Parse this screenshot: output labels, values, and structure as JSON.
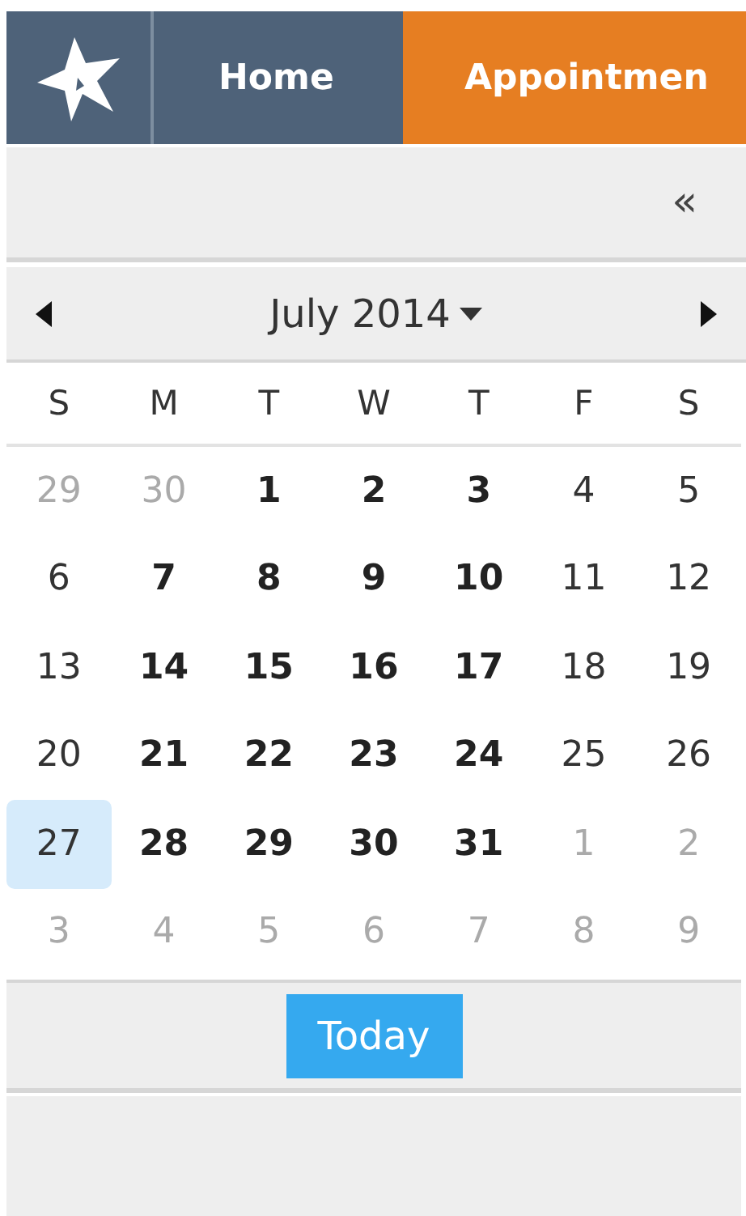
{
  "nav": {
    "tabs": [
      {
        "label": "Home",
        "selected": false
      },
      {
        "label": "Appointmen",
        "selected": true
      }
    ]
  },
  "toolbar": {
    "collapse": "«"
  },
  "calendar": {
    "month": "July 2014",
    "weekdays": [
      "S",
      "M",
      "T",
      "W",
      "T",
      "F",
      "S"
    ],
    "weeks": [
      [
        {
          "day": "29",
          "kind": "outside",
          "selected": false
        },
        {
          "day": "30",
          "kind": "outside",
          "selected": false
        },
        {
          "day": "1",
          "kind": "booked",
          "selected": false
        },
        {
          "day": "2",
          "kind": "booked",
          "selected": false
        },
        {
          "day": "3",
          "kind": "booked",
          "selected": false
        },
        {
          "day": "4",
          "kind": "plain",
          "selected": false
        },
        {
          "day": "5",
          "kind": "plain",
          "selected": false
        }
      ],
      [
        {
          "day": "6",
          "kind": "plain",
          "selected": false
        },
        {
          "day": "7",
          "kind": "booked",
          "selected": false
        },
        {
          "day": "8",
          "kind": "booked",
          "selected": false
        },
        {
          "day": "9",
          "kind": "booked",
          "selected": false
        },
        {
          "day": "10",
          "kind": "booked",
          "selected": false
        },
        {
          "day": "11",
          "kind": "plain",
          "selected": false
        },
        {
          "day": "12",
          "kind": "plain",
          "selected": false
        }
      ],
      [
        {
          "day": "13",
          "kind": "plain",
          "selected": false
        },
        {
          "day": "14",
          "kind": "booked",
          "selected": false
        },
        {
          "day": "15",
          "kind": "booked",
          "selected": false
        },
        {
          "day": "16",
          "kind": "booked",
          "selected": false
        },
        {
          "day": "17",
          "kind": "booked",
          "selected": false
        },
        {
          "day": "18",
          "kind": "plain",
          "selected": false
        },
        {
          "day": "19",
          "kind": "plain",
          "selected": false
        }
      ],
      [
        {
          "day": "20",
          "kind": "plain",
          "selected": false
        },
        {
          "day": "21",
          "kind": "booked",
          "selected": false
        },
        {
          "day": "22",
          "kind": "booked",
          "selected": false
        },
        {
          "day": "23",
          "kind": "booked",
          "selected": false
        },
        {
          "day": "24",
          "kind": "booked",
          "selected": false
        },
        {
          "day": "25",
          "kind": "plain",
          "selected": false
        },
        {
          "day": "26",
          "kind": "plain",
          "selected": false
        }
      ],
      [
        {
          "day": "27",
          "kind": "plain",
          "selected": true
        },
        {
          "day": "28",
          "kind": "booked",
          "selected": false
        },
        {
          "day": "29",
          "kind": "booked",
          "selected": false
        },
        {
          "day": "30",
          "kind": "booked",
          "selected": false
        },
        {
          "day": "31",
          "kind": "booked",
          "selected": false
        },
        {
          "day": "1",
          "kind": "outside",
          "selected": false
        },
        {
          "day": "2",
          "kind": "outside",
          "selected": false
        }
      ],
      [
        {
          "day": "3",
          "kind": "outside",
          "selected": false
        },
        {
          "day": "4",
          "kind": "outside",
          "selected": false
        },
        {
          "day": "5",
          "kind": "outside",
          "selected": false
        },
        {
          "day": "6",
          "kind": "outside",
          "selected": false
        },
        {
          "day": "7",
          "kind": "outside",
          "selected": false
        },
        {
          "day": "8",
          "kind": "outside",
          "selected": false
        },
        {
          "day": "9",
          "kind": "outside",
          "selected": false
        }
      ]
    ],
    "today_button": "Today"
  }
}
